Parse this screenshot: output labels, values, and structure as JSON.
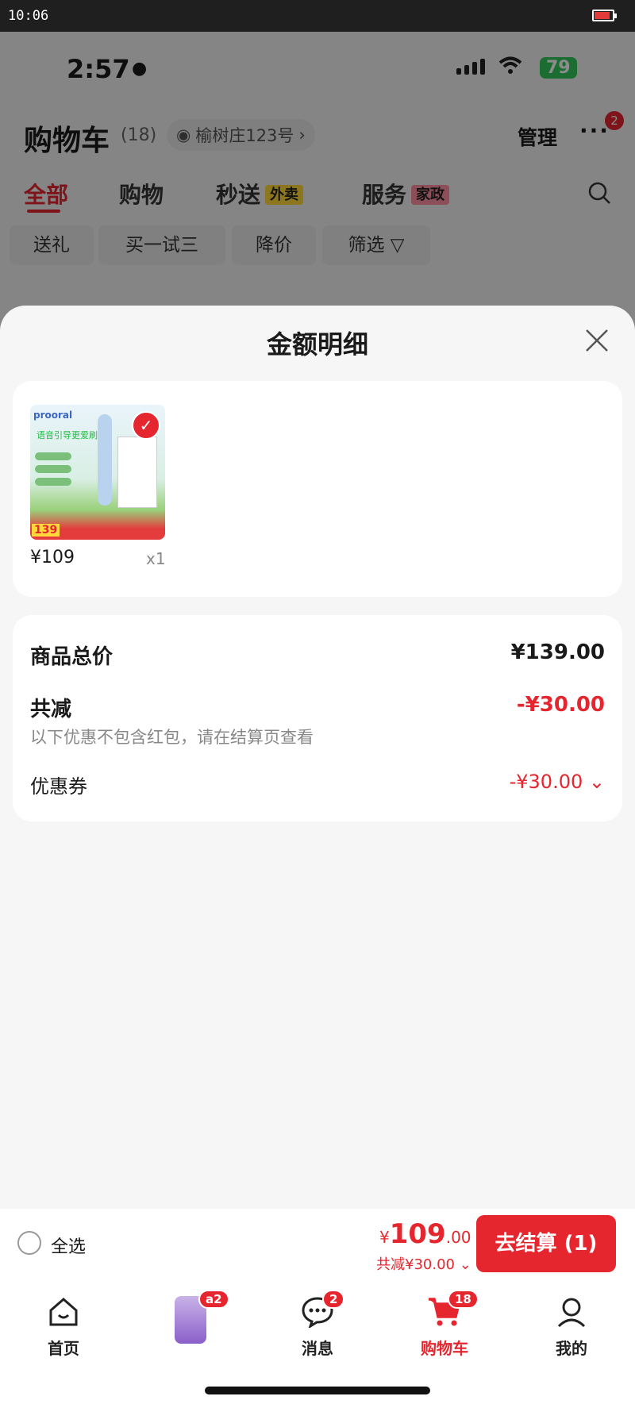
{
  "device": {
    "outer_time": "10:06"
  },
  "status_bar": {
    "time": "2:57",
    "battery": "79"
  },
  "cart": {
    "title": "购物车",
    "count": "(18)",
    "address": "榆树庄123号",
    "manage": "管理",
    "more_badge": "2"
  },
  "tabs": [
    {
      "label": "全部"
    },
    {
      "label": "购物"
    },
    {
      "label": "秒送",
      "tag": "外卖"
    },
    {
      "label": "服务",
      "tag": "家政"
    }
  ],
  "chips": [
    "送礼",
    "买一试三",
    "降价",
    "筛选"
  ],
  "sheet": {
    "title": "金额明细",
    "product": {
      "price": "¥109",
      "qty": "x1",
      "thumb_brand": "prooral",
      "thumb_headline": "语音引导更爱刷牙",
      "thumb_price": "139"
    },
    "summary": {
      "total_label": "商品总价",
      "total_value": "¥139.00",
      "discount_label": "共减",
      "discount_value": "-¥30.00",
      "note": "以下优惠不包含红包，请在结算页查看",
      "coupon_label": "优惠券",
      "coupon_value": "-¥30.00"
    }
  },
  "bottom": {
    "select_all": "全选",
    "total_currency": "¥",
    "total_int": "109",
    "total_dec": ".00",
    "saved": "共减¥30.00",
    "checkout": "去结算 (1)"
  },
  "nav": [
    {
      "label": "首页",
      "icon": "home-icon"
    },
    {
      "label": "",
      "icon": "product-thumb",
      "badge": "a2"
    },
    {
      "label": "消息",
      "icon": "message-icon",
      "badge": "2"
    },
    {
      "label": "购物车",
      "icon": "cart-icon",
      "badge": "18"
    },
    {
      "label": "我的",
      "icon": "profile-icon"
    }
  ],
  "colors": {
    "accent": "#e5262f",
    "tag_yellow": "#ffd93a",
    "battery": "#34c759"
  }
}
